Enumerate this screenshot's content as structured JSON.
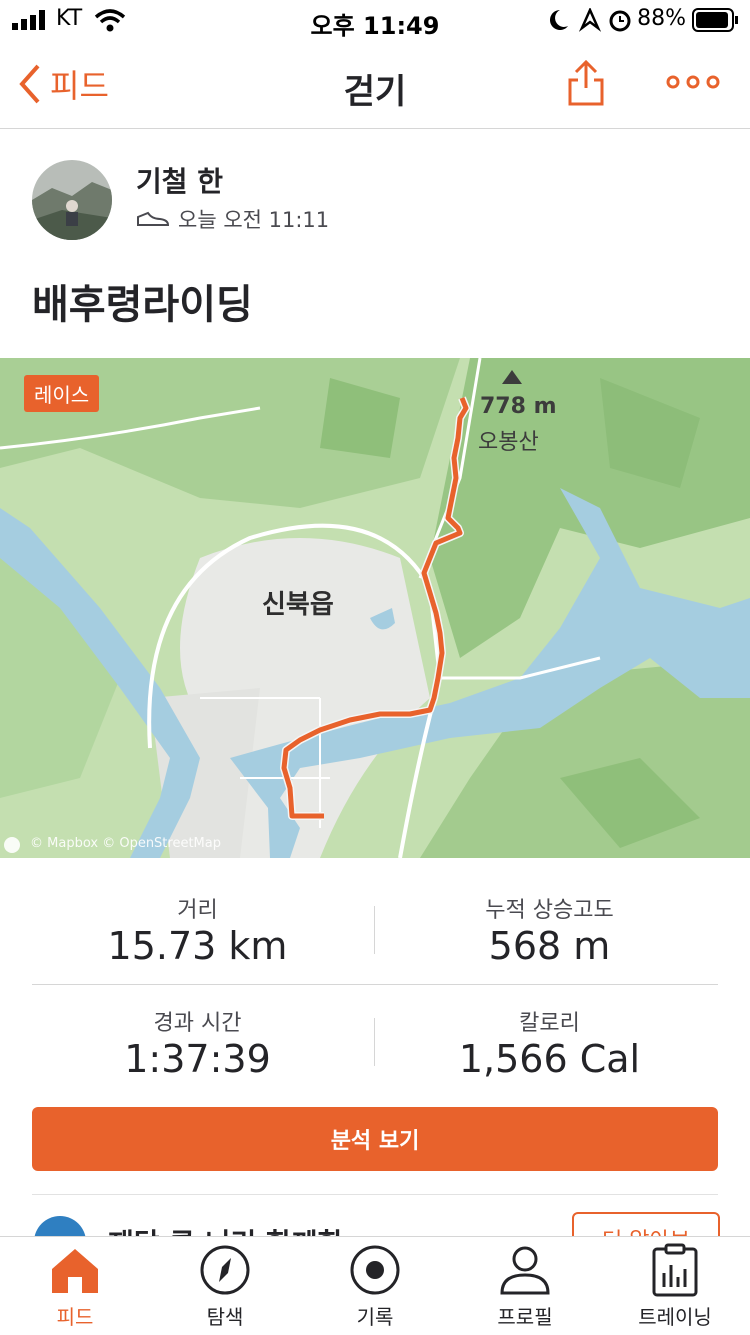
{
  "status_bar": {
    "carrier": "KT",
    "time": "오후 11:49",
    "battery": "88%"
  },
  "nav": {
    "back_label": "피드",
    "title": "걷기"
  },
  "activity": {
    "user_name": "기철 한",
    "timestamp": "오늘 오전 11:11",
    "title": "배후령라이딩",
    "race_badge": "레이스",
    "peak_altitude": "778 m",
    "peak_name": "오봉산",
    "town_label": "신북읍",
    "map_attribution": "© Mapbox © OpenStreetMap"
  },
  "stats": {
    "distance_label": "거리",
    "distance_value": "15.73 km",
    "elevation_label": "누적 상승고도",
    "elevation_value": "568 m",
    "time_label": "경과 시간",
    "time_value": "1:37:39",
    "calories_label": "칼로리",
    "calories_value": "1,566 Cal"
  },
  "analysis_button": "분석 보기",
  "peek": {
    "text": "재담 클 니리 합께합",
    "button": "더 알아보"
  },
  "tabs": [
    {
      "label": "피드"
    },
    {
      "label": "탐색"
    },
    {
      "label": "기록"
    },
    {
      "label": "프로필"
    },
    {
      "label": "트레이닝"
    }
  ],
  "colors": {
    "accent": "#e8622c",
    "map_green": "#c4dfb0",
    "map_water": "#a5cde0"
  }
}
